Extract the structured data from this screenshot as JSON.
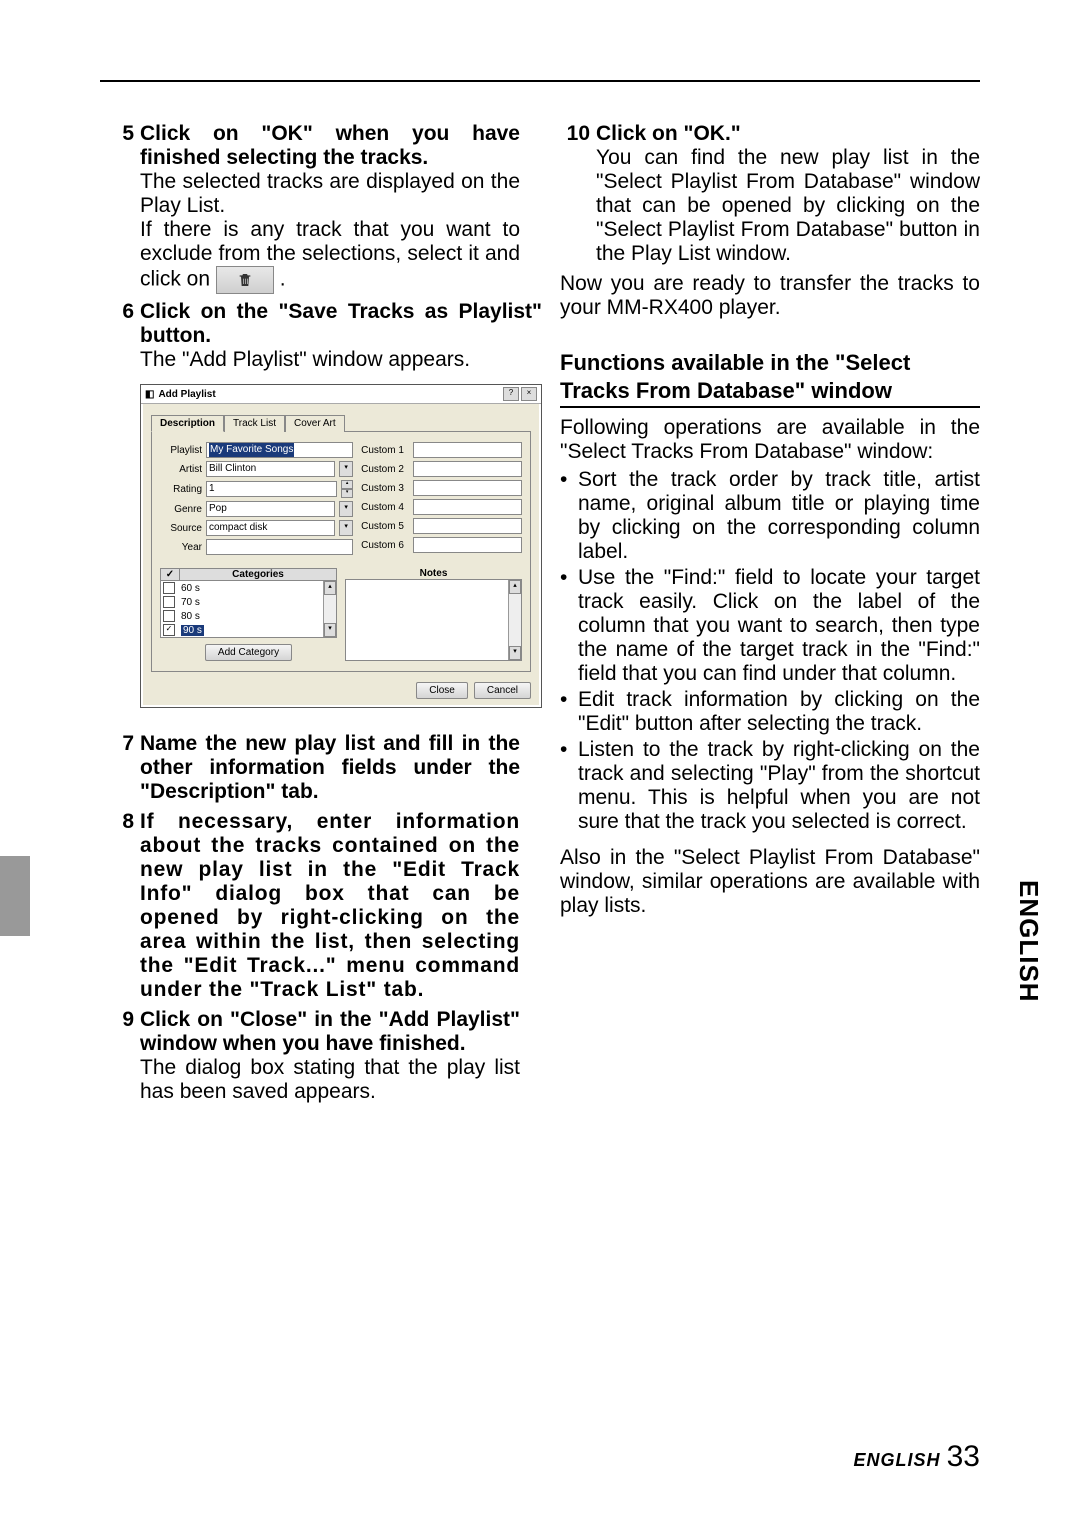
{
  "side_label": "ENGLISH",
  "footer": {
    "lang": "ENGLISH",
    "page": "33"
  },
  "left": {
    "step5": {
      "num": "5",
      "title": "Click on \"OK\" when you have finished selecting the tracks.",
      "body1": "The selected tracks are displayed on the Play List.",
      "body2_a": "If there is any track that you want to exclude from the selections, select it and click on ",
      "body2_b": "."
    },
    "step6": {
      "num": "6",
      "title": "Click on the \"Save Tracks as Playlist\" button.",
      "body": "The \"Add Playlist\" window appears."
    },
    "dialog": {
      "title": "Add Playlist",
      "tabs": [
        "Description",
        "Track List",
        "Cover Art"
      ],
      "fields": {
        "playlist_label": "Playlist",
        "playlist_value": "My Favorite Songs",
        "artist_label": "Artist",
        "artist_value": "Bill Clinton",
        "rating_label": "Rating",
        "rating_value": "1",
        "genre_label": "Genre",
        "genre_value": "Pop",
        "source_label": "Source",
        "source_value": "compact disk",
        "year_label": "Year",
        "year_value": ""
      },
      "customs": [
        "Custom 1",
        "Custom 2",
        "Custom 3",
        "Custom 4",
        "Custom 5",
        "Custom 6"
      ],
      "categories_header_check": "✓",
      "categories_header_name": "Categories",
      "categories": [
        {
          "label": "60 s",
          "checked": false
        },
        {
          "label": "70 s",
          "checked": false
        },
        {
          "label": "80 s",
          "checked": false
        },
        {
          "label": "90 s",
          "checked": true
        }
      ],
      "add_category_btn": "Add Category",
      "notes_header": "Notes",
      "close_btn": "Close",
      "cancel_btn": "Cancel"
    },
    "step7": {
      "num": "7",
      "title": "Name the new play list and fill in the other information fields under the \"Description\" tab."
    },
    "step8": {
      "num": "8",
      "title": "If necessary, enter information about the tracks contained on the new play list in the \"Edit Track Info\" dialog box that can be opened by right-clicking on the area within the list, then selecting the \"Edit Track...\" menu command under the \"Track List\" tab."
    },
    "step9": {
      "num": "9",
      "title": "Click on \"Close\" in the \"Add Playlist\" window when you have finished.",
      "body": "The dialog box stating that the play list has been saved appears."
    }
  },
  "right": {
    "step10": {
      "num": "10",
      "title": "Click on \"OK.\"",
      "body": "You can find the new play list in the \"Select Playlist From Database\" window that can be opened by clicking on the \"Select Playlist From Database\" button in the Play List window."
    },
    "transfer": "Now you are ready to transfer the tracks to your MM-RX400 player.",
    "section_title1": "Functions available in the \"Select",
    "section_title2": "Tracks From Database\" window",
    "intro": "Following operations are available in the \"Select Tracks From Database\" window:",
    "bullets": [
      "Sort the track order by track title, artist name, original album title or playing time by clicking on the corresponding column label.",
      "Use the \"Find:\" field to locate your target track easily. Click on the label of the column that you want to search, then type the name of the target track in the \"Find:\" field that you can find under that column.",
      "Edit track information by clicking on the \"Edit\" button after selecting the track.",
      "Listen to the track by right-clicking on the track and selecting \"Play\" from the shortcut menu. This is helpful when you are not sure that the track you selected is correct."
    ],
    "outro": "Also in the \"Select Playlist From Database\" window, similar operations are available with play lists."
  }
}
